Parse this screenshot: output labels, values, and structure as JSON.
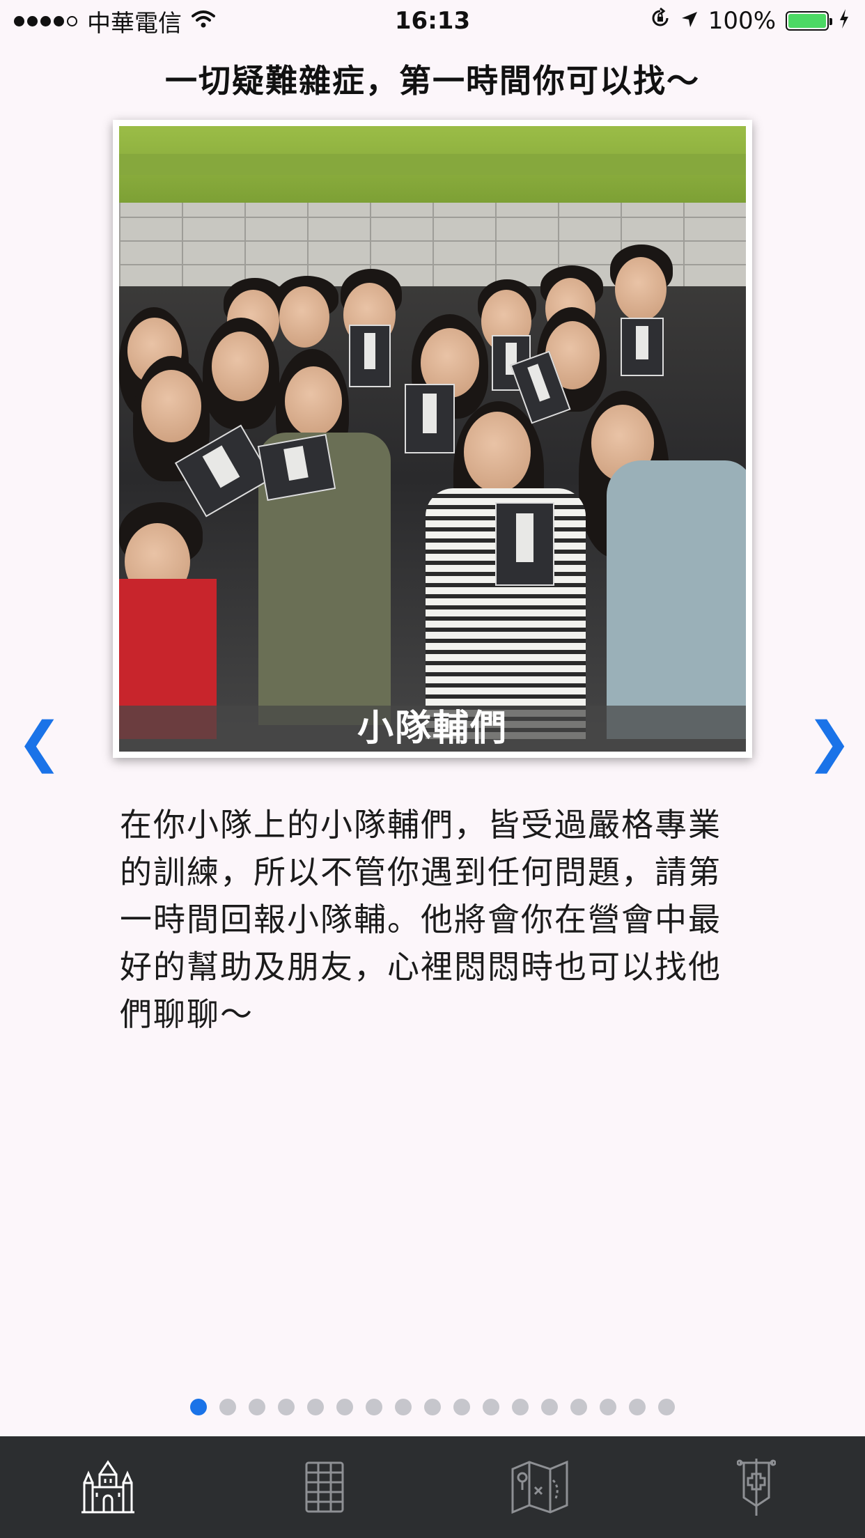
{
  "status_bar": {
    "carrier": "中華電信",
    "time": "16:13",
    "battery": "100%",
    "signal_bars": 4,
    "signal_total": 5
  },
  "header": {
    "title": "一切疑難雜症，第一時間你可以找～"
  },
  "card": {
    "caption": "小隊輔們",
    "description": "在你小隊上的小隊輔們，皆受過嚴格專業的訓練，所以不管你遇到任何問題，請第一時間回報小隊輔。他將會你在營會中最好的幫助及朋友，心裡悶悶時也可以找他們聊聊～"
  },
  "nav": {
    "prev_glyph": "❮",
    "next_glyph": "❯"
  },
  "pager": {
    "total": 17,
    "active_index": 0
  },
  "tab_bar": {
    "tabs": [
      {
        "icon": "castle-icon",
        "active": true
      },
      {
        "icon": "grid-icon",
        "active": false
      },
      {
        "icon": "map-icon",
        "active": false
      },
      {
        "icon": "banner-cross-icon",
        "active": false
      }
    ]
  },
  "colors": {
    "accent": "#1a73e8",
    "background": "#fcf6fa",
    "tab_bar": "#2c2e30",
    "battery": "#4cd964"
  }
}
